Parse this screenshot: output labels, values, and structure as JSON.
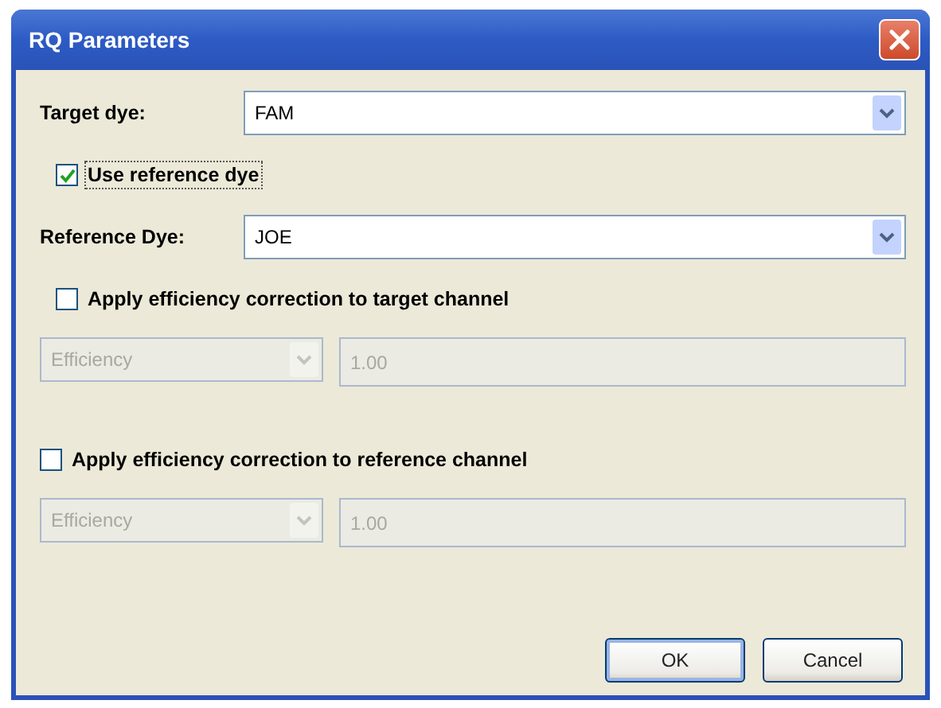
{
  "window": {
    "title": "RQ Parameters"
  },
  "target_dye": {
    "label": "Target dye:",
    "value": "FAM"
  },
  "use_reference": {
    "label": "Use reference dye",
    "checked": true,
    "focused": true
  },
  "reference_dye": {
    "label": "Reference Dye:",
    "value": "JOE"
  },
  "corrections": [
    {
      "label": "Apply efficiency correction to target channel",
      "checked": false,
      "method": "Efficiency",
      "value": "1.00",
      "disabled": true
    },
    {
      "label": "Apply efficiency correction to reference channel",
      "checked": false,
      "method": "Efficiency",
      "value": "1.00",
      "disabled": true
    }
  ],
  "buttons": [
    {
      "label": "OK",
      "default": true
    },
    {
      "label": "Cancel",
      "default": false
    }
  ]
}
